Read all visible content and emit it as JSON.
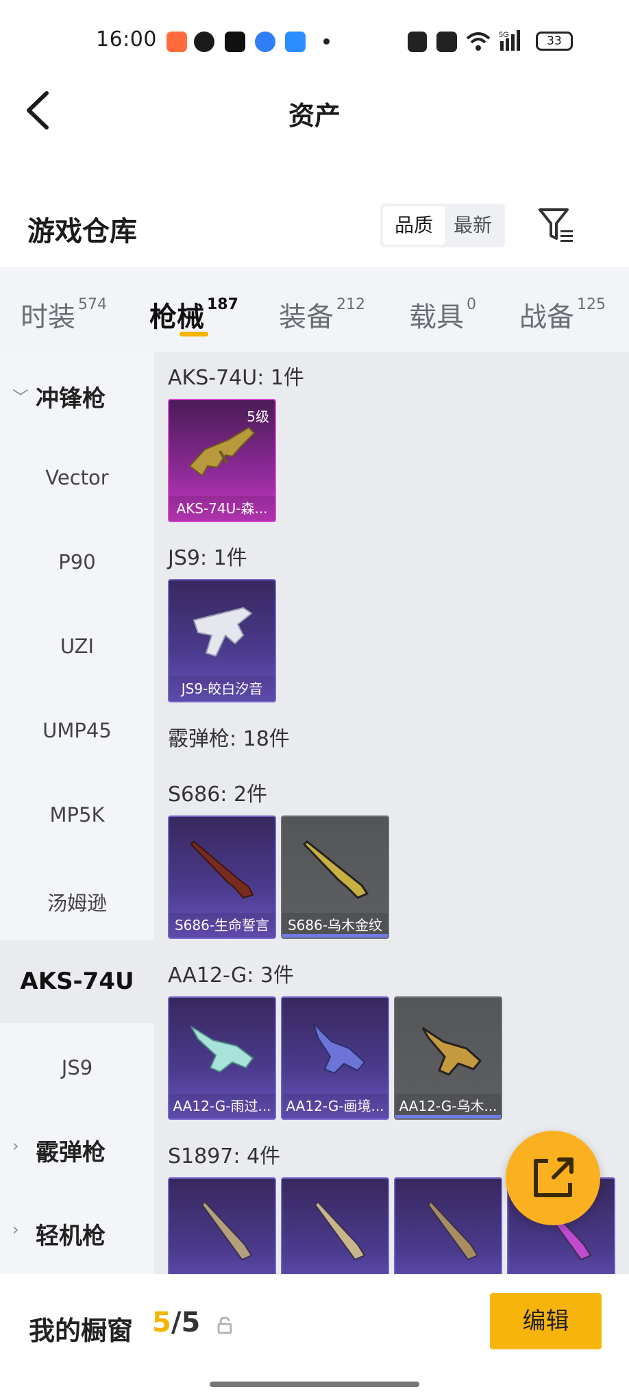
{
  "status_bar": {
    "time": "16:00",
    "battery": "33",
    "network": "5G"
  },
  "header": {
    "title": "资产",
    "back_label": ""
  },
  "warehouse": {
    "title": "游戏仓库",
    "sort": {
      "options": [
        "品质",
        "最新"
      ],
      "selected": "品质"
    }
  },
  "tabs": [
    {
      "label": "时装",
      "count": "574"
    },
    {
      "label": "枪械",
      "count": "187",
      "active": true
    },
    {
      "label": "装备",
      "count": "212"
    },
    {
      "label": "载具",
      "count": "0"
    },
    {
      "label": "战备",
      "count": "125"
    }
  ],
  "sidebar": {
    "groups": [
      {
        "label": "冲锋枪",
        "expanded": true
      },
      {
        "label": "霰弹枪",
        "expanded": false
      },
      {
        "label": "轻机枪",
        "expanded": false
      }
    ],
    "items": [
      "Vector",
      "P90",
      "UZI",
      "UMP45",
      "MP5K",
      "汤姆逊",
      "AKS-74U",
      "JS9"
    ],
    "active_item": "AKS-74U"
  },
  "content": {
    "groups": [
      {
        "header": "AKS-74U: 1件",
        "items": [
          {
            "name": "AKS-74U-森...",
            "level": "5级",
            "rarity": "magenta"
          }
        ]
      },
      {
        "header": "JS9: 1件",
        "items": [
          {
            "name": "JS9-皎白汐音",
            "rarity": "purple"
          }
        ]
      },
      {
        "header": "霰弹枪: 18件",
        "items": []
      },
      {
        "header": "S686: 2件",
        "items": [
          {
            "name": "S686-生命誓言",
            "rarity": "purple"
          },
          {
            "name": "S686-乌木金纹",
            "rarity": "gray"
          }
        ]
      },
      {
        "header": "AA12-G: 3件",
        "items": [
          {
            "name": "AA12-G-雨过...",
            "rarity": "purple"
          },
          {
            "name": "AA12-G-画境...",
            "rarity": "purple"
          },
          {
            "name": "AA12-G-乌木...",
            "rarity": "gray"
          }
        ]
      },
      {
        "header": "S1897: 4件",
        "items": [
          {
            "name": "",
            "rarity": "purple"
          },
          {
            "name": "",
            "rarity": "purple"
          },
          {
            "name": "",
            "rarity": "purple"
          },
          {
            "name": "",
            "rarity": "purple"
          }
        ]
      }
    ]
  },
  "bottom": {
    "showcase_label": "我的橱窗",
    "current": "5",
    "separator": "/",
    "total": "5",
    "edit_label": "编辑"
  },
  "colors": {
    "accent": "#f7b40a",
    "purple_card": "#4b3b8d",
    "magenta_card": "#8d2a97",
    "gray_card": "#5d5f62"
  }
}
